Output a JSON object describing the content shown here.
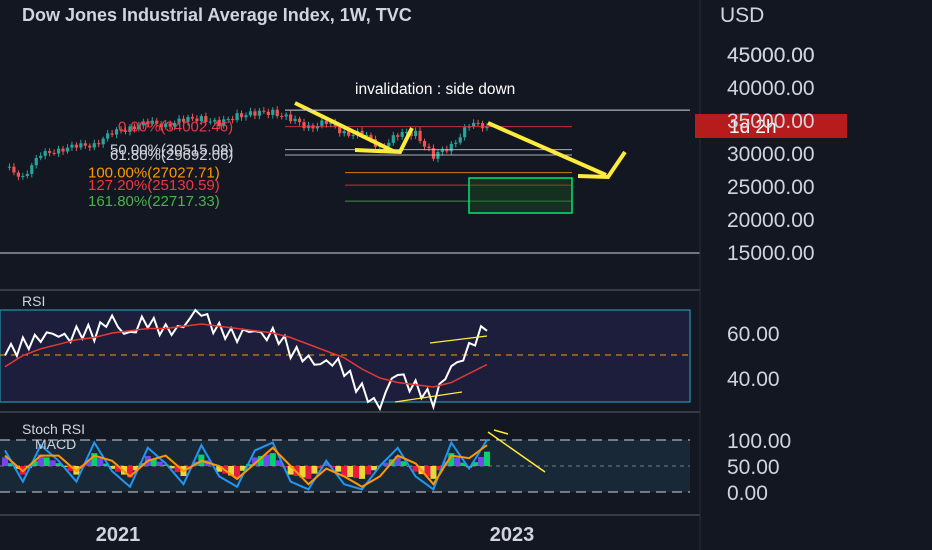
{
  "header": {
    "symbol": "Dow Jones Industrial Average Index, 1W, TVC",
    "currency": "USD"
  },
  "price_axis": {
    "labels": [
      "45000.00",
      "40000.00",
      "35000.00",
      "30000.00",
      "25000.00",
      "20000.00",
      "15000.00"
    ],
    "values": [
      45000,
      40000,
      35000,
      30000,
      25000,
      20000,
      15000
    ],
    "countdown": "1d 2h"
  },
  "rsi_axis": {
    "labels": [
      "60.00",
      "40.00"
    ],
    "values": [
      60,
      40
    ]
  },
  "stoch_axis": {
    "labels": [
      "100.00",
      "50.00",
      "0.00"
    ],
    "values": [
      100,
      50,
      0
    ]
  },
  "time_axis": {
    "labels": [
      "2021",
      "2023"
    ]
  },
  "panes": {
    "rsi_title": "RSI",
    "stoch_title": "Stoch RSI",
    "macd_title": "MACD"
  },
  "annotations": {
    "invalidation": "invalidation : side down",
    "invalidation_level": 36500
  },
  "fib_levels": [
    {
      "label": "0.00%(34002.46)",
      "price": 34002.46,
      "color": "#f23645"
    },
    {
      "label": "50.00%(30515.08)",
      "price": 30515.08,
      "color": "#d1d4dc"
    },
    {
      "label": "61.80%(29692.06)",
      "price": 29692.06,
      "color": "#d1d4dc"
    },
    {
      "label": "100.00%(27027.71)",
      "price": 27027.71,
      "color": "#ff9800"
    },
    {
      "label": "127.20%(25130.59)",
      "price": 25130.59,
      "color": "#f23645"
    },
    {
      "label": "161.80%(22717.33)",
      "price": 22717.33,
      "color": "#4caf50"
    }
  ],
  "colors": {
    "background": "#131722",
    "up": "#26a69a",
    "down": "#ef5350",
    "arrow": "#ffeb3b",
    "rsi": "#ffffff",
    "rsi_ma": "#e53935"
  },
  "chart_data": [
    {
      "type": "candlestick",
      "title": "Dow Jones Industrial Average Index, 1W, TVC",
      "ylim": [
        15000,
        45000
      ],
      "x": [
        "2020-09",
        "2020-10",
        "2020-11",
        "2020-12",
        "2021-01",
        "2021-02",
        "2021-03",
        "2021-04",
        "2021-05",
        "2021-06",
        "2021-07",
        "2021-08",
        "2021-09",
        "2021-10",
        "2021-11",
        "2021-12",
        "2022-01",
        "2022-02",
        "2022-03",
        "2022-04",
        "2022-05",
        "2022-06",
        "2022-07",
        "2022-08",
        "2022-09",
        "2022-10",
        "2022-11",
        "2022-12"
      ],
      "close": [
        27800,
        26500,
        29600,
        30600,
        30900,
        31400,
        32900,
        33900,
        34500,
        34300,
        34900,
        35400,
        34300,
        35800,
        35900,
        36300,
        35100,
        33900,
        34700,
        33000,
        32900,
        30800,
        32800,
        33000,
        29500,
        31000,
        34400,
        34000
      ]
    },
    {
      "type": "line",
      "title": "RSI",
      "ylim": [
        25,
        75
      ],
      "series": [
        {
          "name": "RSI",
          "values": [
            50,
            55,
            60,
            56,
            62,
            60,
            64,
            62,
            64,
            60,
            66,
            67,
            62,
            60,
            58,
            62,
            52,
            46,
            50,
            42,
            34,
            30,
            40,
            37,
            31,
            42,
            56,
            61
          ]
        },
        {
          "name": "RSI MA",
          "values": [
            45,
            50,
            53,
            55,
            57,
            58,
            60,
            61,
            62,
            62,
            63,
            64,
            63,
            62,
            61,
            60,
            58,
            55,
            52,
            49,
            44,
            40,
            38,
            37,
            36,
            38,
            42,
            46
          ]
        }
      ]
    },
    {
      "type": "line",
      "title": "Stoch RSI",
      "ylim": [
        0,
        100
      ],
      "series": [
        {
          "name": "%K",
          "values": [
            80,
            20,
            90,
            60,
            20,
            95,
            40,
            10,
            85,
            55,
            15,
            90,
            30,
            10,
            80,
            95,
            20,
            5,
            60,
            15,
            5,
            50,
            85,
            30,
            5,
            95,
            45,
            100
          ]
        },
        {
          "name": "%D",
          "values": [
            70,
            40,
            70,
            70,
            40,
            70,
            60,
            30,
            60,
            70,
            40,
            60,
            50,
            25,
            55,
            85,
            50,
            15,
            45,
            30,
            10,
            30,
            70,
            55,
            15,
            70,
            65,
            90
          ]
        }
      ]
    }
  ]
}
